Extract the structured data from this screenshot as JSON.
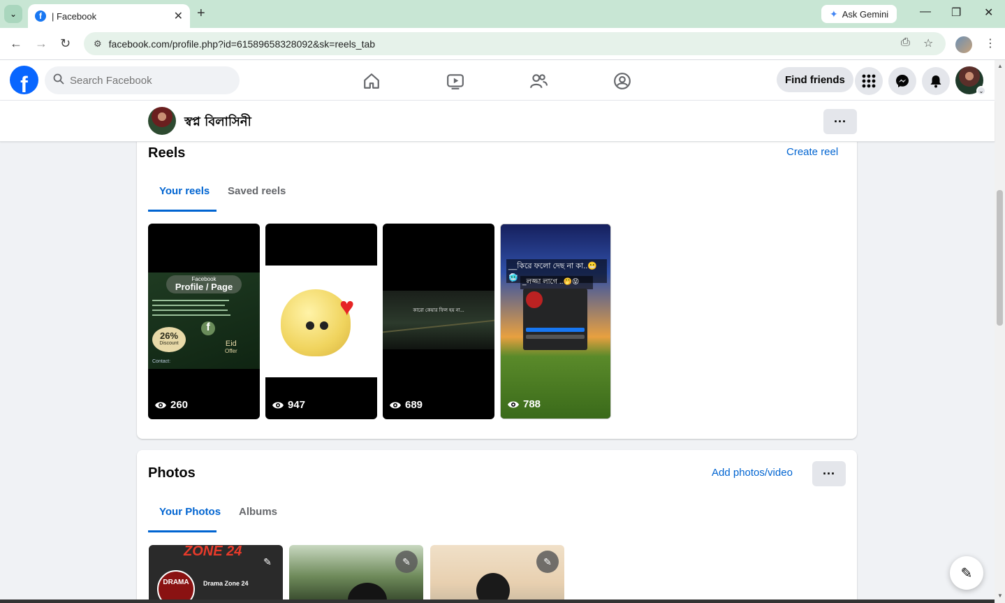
{
  "browser": {
    "tab_title": "| Facebook",
    "tab_close": "✕",
    "new_tab": "+",
    "gemini_label": "Ask Gemini",
    "url": "facebook.com/profile.php?id=61589658328092&sk=reels_tab"
  },
  "fb": {
    "search_placeholder": "Search Facebook",
    "find_friends": "Find friends"
  },
  "profile": {
    "name": "স্বপ্ন বিলাসিনী",
    "more": "···"
  },
  "reels": {
    "title": "Reels",
    "create": "Create reel",
    "tabs": [
      "Your reels",
      "Saved reels"
    ],
    "items": [
      {
        "views": "260",
        "top_text": "Facebook",
        "headline": "Profile / Page",
        "badge": "26%",
        "badge_sub": "Discount",
        "offer": "Eid",
        "offer_sub": "Offer",
        "contact": "Contact:"
      },
      {
        "views": "947"
      },
      {
        "views": "689",
        "caption": "কারো কেয়ার ফিল হয় না..."
      },
      {
        "views": "788",
        "caption": "__কিরে ফলো দেছ না কা..😬🥶",
        "caption2": "_লজ্জা লাগে ..🤭😝"
      }
    ]
  },
  "photos": {
    "title": "Photos",
    "add": "Add photos/video",
    "more": "···",
    "tabs": [
      "Your Photos",
      "Albums"
    ],
    "items": [
      {
        "banner": "ZONE 24",
        "logo": "DRAMA",
        "page_name": "Drama Zone 24"
      },
      {},
      {}
    ]
  },
  "colors": {
    "fb_blue": "#0866ff",
    "link_blue": "#0064d1",
    "background": "#f0f2f5"
  }
}
